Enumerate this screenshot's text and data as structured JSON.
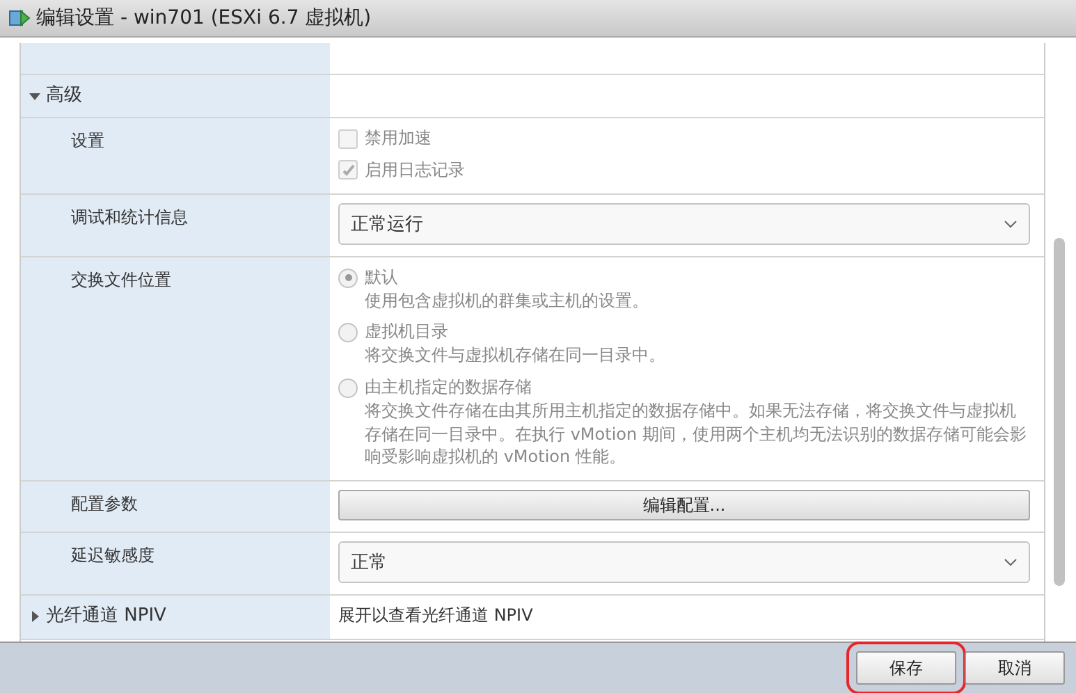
{
  "window": {
    "title": "编辑设置 - win701 (ESXi 6.7 虚拟机)"
  },
  "sections": [
    {
      "label": "高级",
      "expanded": true,
      "rows": [
        {
          "kind": "checkboxes",
          "label": "设置",
          "options": [
            {
              "label": "禁用加速",
              "checked": false,
              "disabled": true
            },
            {
              "label": "启用日志记录",
              "checked": true,
              "disabled": true
            }
          ]
        },
        {
          "kind": "select",
          "label": "调试和统计信息",
          "value": "正常运行"
        },
        {
          "kind": "radios",
          "label": "交换文件位置",
          "options": [
            {
              "label": "默认",
              "description": "使用包含虚拟机的群集或主机的设置。",
              "selected": true
            },
            {
              "label": "虚拟机目录",
              "description": "将交换文件与虚拟机存储在同一目录中。",
              "selected": false
            },
            {
              "label": "由主机指定的数据存储",
              "description": "将交换文件存储在由其所用主机指定的数据存储中。如果无法存储，将交换文件与虚拟机存储在同一目录中。在执行 vMotion 期间，使用两个主机均无法识别的数据存储可能会影响受影响虚拟机的 vMotion 性能。",
              "selected": false
            }
          ]
        },
        {
          "kind": "button",
          "label": "配置参数",
          "value": "编辑配置..."
        },
        {
          "kind": "select",
          "label": "延迟敏感度",
          "value": "正常"
        }
      ]
    },
    {
      "label": "光纤通道 NPIV",
      "expanded": false,
      "summary": "展开以查看光纤通道 NPIV"
    }
  ],
  "footer": {
    "buttons": [
      {
        "label": "保存",
        "highlighted": true
      },
      {
        "label": "取消",
        "highlighted": false
      }
    ]
  }
}
